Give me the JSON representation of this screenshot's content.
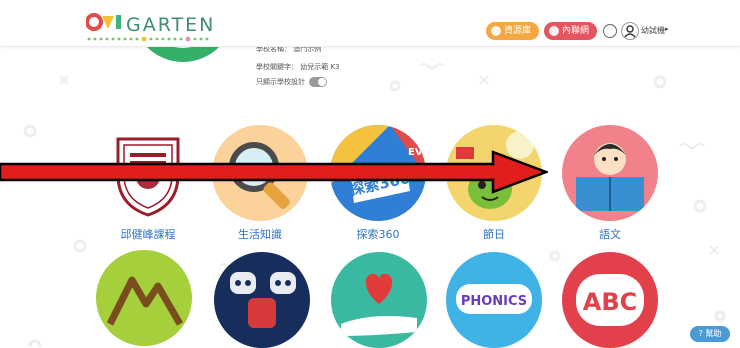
{
  "header": {
    "logo_text": "GARTEN",
    "btn_orange_label": "資源庫",
    "btn_red_label": "內聯網",
    "user_name": "幼試機"
  },
  "info": {
    "row1": "學校名稱：    澳門示例    ",
    "row2": "學校關鍵字：  幼兒示範    K3",
    "row3": "只顯示學校設計"
  },
  "tiles": [
    {
      "label": "邱健峰課程"
    },
    {
      "label": "生活知識"
    },
    {
      "label": "探索360"
    },
    {
      "label": "節日"
    },
    {
      "label": "語文"
    }
  ],
  "tile_art": {
    "phonics": "PHONICS",
    "abc": "ABC",
    "badge_360": "探索360",
    "evi": "EVI"
  },
  "help": {
    "label": "幫助"
  }
}
